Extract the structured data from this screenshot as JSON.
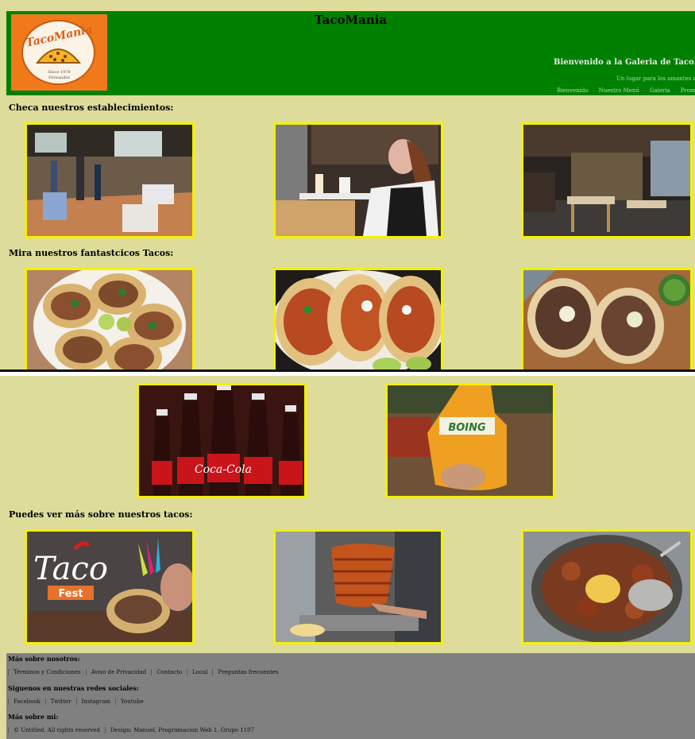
{
  "header": {
    "site_title": "TacoMania",
    "logo_text": "TacoMania",
    "logo_subtext": "Since 1978",
    "logo_subtext2": "Fernandez",
    "welcome": "Bienvenido a la Galeria de TacoMani",
    "tagline": "Un lugar para los amantes del M",
    "nav": [
      "Bienvenido",
      "Nuestro Menú",
      "Galeria",
      "Promocio"
    ]
  },
  "sections": {
    "establishments_title": "Checa nuestros establecimientos:",
    "tacos_title": "Mira nuestros fantastcicos Tacos:",
    "more_tacos_title": "Puedes ver más sobre nuestros tacos:"
  },
  "images": {
    "establishment_1": "restaurant-dining-room-photo",
    "establishment_2": "waitress-serving-drinks-photo",
    "establishment_3": "dark-restaurant-interior-photo",
    "taco_1": "tacos-on-white-plate-photo",
    "taco_2": "tacos-with-lime-photo",
    "taco_3": "tacos-on-wooden-board-photo",
    "drink_1": "coca-cola-bottles-photo",
    "drink_2": "boing-juice-bottle-photo",
    "more_1": "taco-fest-banner-photo",
    "more_2": "trompo-al-pastor-photo",
    "more_3": "mixed-meats-pan-photo"
  },
  "drink_labels": {
    "coca": "Coca-Cola",
    "boing": "BOING",
    "tacofest_1": "Taco",
    "tacofest_2": "Fest"
  },
  "footer": {
    "about_title": "Más sobre nosotros:",
    "about_links": [
      "Términos y Condiciones",
      "Aviso de Privacidad",
      "Contacto",
      "Local",
      "Preguntas frecuentes"
    ],
    "social_title": "Siguenos en nuestras redes sociales:",
    "social_links": [
      "Facebook",
      "Twitter",
      "Instagram",
      "Youtube"
    ],
    "me_title": "Más sobre mi:",
    "me_links": [
      "© Untitled. All rights reserved",
      "Design: Manuel, Programacion Web 1, Grupo 1107"
    ]
  },
  "colors": {
    "page_bg": "#dddc9a",
    "header_bg": "#008000",
    "frame": "#f3f100",
    "footer_bg": "#808080"
  }
}
